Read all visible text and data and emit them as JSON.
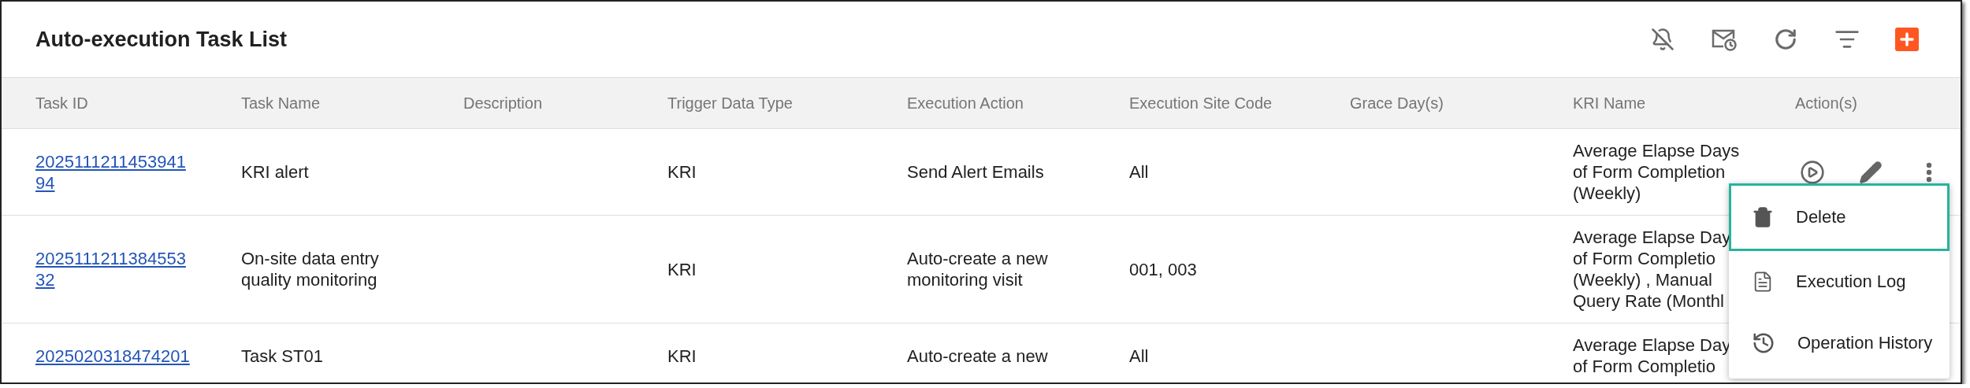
{
  "title": "Auto-execution Task List",
  "columns": [
    "Task ID",
    "Task Name",
    "Description",
    "Trigger Data Type",
    "Execution Action",
    "Execution Site Code",
    "Grace Day(s)",
    "KRI Name",
    "Action(s)"
  ],
  "rows": [
    {
      "task_id": "202511121145394194",
      "task_name": "KRI alert",
      "trigger_data_type": "KRI",
      "execution_action": "Send Alert Emails",
      "execution_site_code": "All",
      "kri_name_lines": [
        "Average Elapse Days",
        "of Form Completion",
        "(Weekly)"
      ]
    },
    {
      "task_id": "202511121138455332",
      "task_name": "On-site data entry quality monitoring",
      "trigger_data_type": "KRI",
      "execution_action": "Auto-create a new monitoring visit",
      "execution_site_code": "001, 003",
      "kri_name_lines": [
        "Average Elapse Day",
        "of Form Completio",
        "(Weekly) , Manual",
        "Query Rate (Monthl"
      ]
    },
    {
      "task_id": "2025020318474201",
      "task_name": "Task ST01",
      "trigger_data_type": "KRI",
      "execution_action": "Auto-create a new",
      "execution_site_code": "All",
      "kri_name_lines": [
        "Average Elapse Day",
        "of Form Completio"
      ]
    }
  ],
  "row_menu": {
    "items": [
      {
        "kind": "delete",
        "label": "Delete",
        "selected": true
      },
      {
        "kind": "log",
        "label": "Execution Log",
        "selected": false
      },
      {
        "kind": "history",
        "label": "Operation History",
        "selected": false
      }
    ]
  }
}
